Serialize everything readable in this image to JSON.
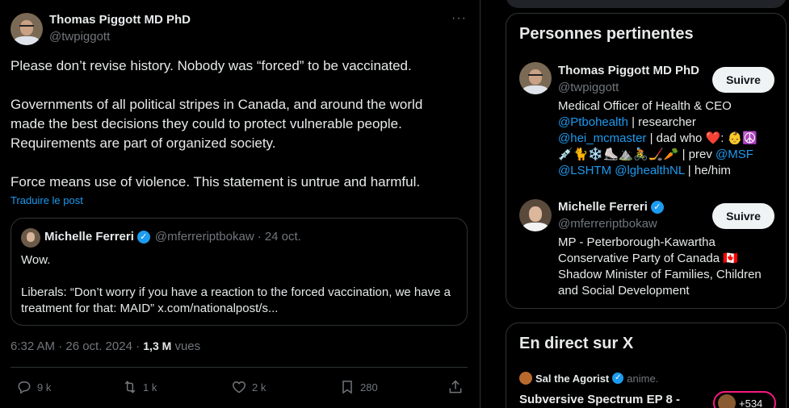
{
  "post": {
    "author_name": "Thomas Piggott MD PhD",
    "author_handle": "@twpiggott",
    "more_label": "···",
    "paragraphs": [
      "Please don’t revise history. Nobody was “forced” to be vaccinated.",
      "Governments of all political stripes in Canada, and around the world\nmade the best decisions they could to protect vulnerable people.\nRequirements are part of organized society.",
      "Force means use of violence. This statement is untrue and harmful."
    ],
    "translate_label": "Traduire le post",
    "quote": {
      "author_name": "Michelle Ferreri",
      "author_handle": "@mferreriptbokaw",
      "date": "· 24 oct.",
      "line1": "Wow.",
      "line2": "Liberals: “Don’t worry if you have a reaction to the forced vaccination, we have a treatment for that: MAID” x.com/nationalpost/s..."
    },
    "time": "6:32 AM · 26 oct. 2024 ·",
    "views_count": "1,3 M",
    "views_label": "vues",
    "actions": {
      "replies": "9 k",
      "reposts": "1 k",
      "likes": "2 k",
      "bookmarks": "280"
    }
  },
  "sidebar": {
    "relevant": {
      "title": "Personnes pertinentes",
      "people": [
        {
          "name": "Thomas Piggott MD PhD",
          "handle": "@twpiggott",
          "follow_label": "Suivre",
          "bio_l1_text": "Medical Officer of Health & CEO",
          "bio_l2_link": "@Ptbohealth",
          "bio_l2_text": " | researcher",
          "bio_l3_link": "@hei_mcmaster",
          "bio_l3_text": " | dad who ❤️: 👶☮️",
          "bio_l4_text": "💉🐈❄️⛸️⛰️🚴🏒🥕 | prev ",
          "bio_l4_link": "@MSF",
          "bio_l5_link1": "@LSHTM",
          "bio_l5_link2": "@lghealthNL",
          "bio_l5_text": " | he/him"
        },
        {
          "name": "Michelle Ferreri",
          "handle": "@mferreriptbokaw",
          "follow_label": "Suivre",
          "bio_l1_text": "MP - Peterborough-Kawartha",
          "bio_l2_text": "Conservative Party of Canada 🇨🇦",
          "bio_l3_text": "Shadow Minister of Families, Children",
          "bio_l4_text": "and Social Development"
        }
      ]
    },
    "live": {
      "title": "En direct sur X",
      "host_name": "Sal the Agorist",
      "host_status": "anime.",
      "space_title": "Subversive Spectrum EP 8 -",
      "listeners": "+534"
    }
  },
  "colors": {
    "background": "#000000",
    "text": "#e7e9ea",
    "muted": "#71767b",
    "link": "#1d9bf0",
    "border": "#2f3336",
    "button_bg": "#eff3f4",
    "live_accent": "#f91880"
  }
}
